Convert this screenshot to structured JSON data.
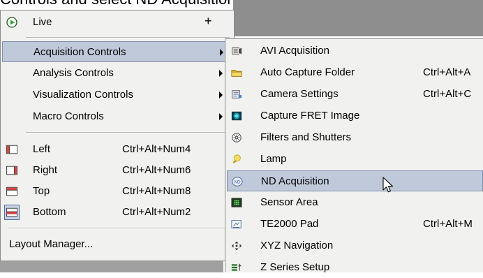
{
  "caption": "Controls and select ND Acquisition.",
  "main_menu": {
    "live": {
      "label": "Live",
      "plus": "+"
    },
    "items": [
      {
        "label": "Acquisition Controls",
        "highlighted": true
      },
      {
        "label": "Analysis Controls"
      },
      {
        "label": "Visualization Controls"
      },
      {
        "label": "Macro Controls"
      }
    ],
    "layout": [
      {
        "label": "Left",
        "shortcut": "Ctrl+Alt+Num4",
        "icon": "dock-left-icon"
      },
      {
        "label": "Right",
        "shortcut": "Ctrl+Alt+Num6",
        "icon": "dock-right-icon"
      },
      {
        "label": "Top",
        "shortcut": "Ctrl+Alt+Num8",
        "icon": "dock-top-icon"
      },
      {
        "label": "Bottom",
        "shortcut": "Ctrl+Alt+Num2",
        "icon": "dock-bottom-icon",
        "selected": true
      }
    ],
    "layout_manager": "Layout Manager..."
  },
  "sub_menu": {
    "items": [
      {
        "label": "AVI Acquisition",
        "shortcut": "",
        "icon": "avi-icon"
      },
      {
        "label": "Auto Capture Folder",
        "shortcut": "Ctrl+Alt+A",
        "icon": "folder-icon"
      },
      {
        "label": "Camera Settings",
        "shortcut": "Ctrl+Alt+C",
        "icon": "camera-settings-icon"
      },
      {
        "label": "Capture FRET Image",
        "shortcut": "",
        "icon": "fret-icon"
      },
      {
        "label": "Filters and Shutters",
        "shortcut": "",
        "icon": "filter-wheel-icon"
      },
      {
        "label": "Lamp",
        "shortcut": "",
        "icon": "lamp-icon"
      },
      {
        "label": "ND Acquisition",
        "shortcut": "",
        "icon": "nd-icon",
        "highlighted": true
      },
      {
        "label": "Sensor Area",
        "shortcut": "",
        "icon": "sensor-icon"
      },
      {
        "label": "TE2000 Pad",
        "shortcut": "Ctrl+Alt+M",
        "icon": "pad-icon"
      },
      {
        "label": "XYZ Navigation",
        "shortcut": "",
        "icon": "xyz-arrows-icon"
      },
      {
        "label": "Z Series Setup",
        "shortcut": "",
        "icon": "z-series-icon"
      }
    ]
  },
  "colors": {
    "menu_bg": "#f1f1ef",
    "highlight": "#bfc9d9",
    "highlight_border": "#7f8fae",
    "dark_bar": "#8e8e8e"
  }
}
